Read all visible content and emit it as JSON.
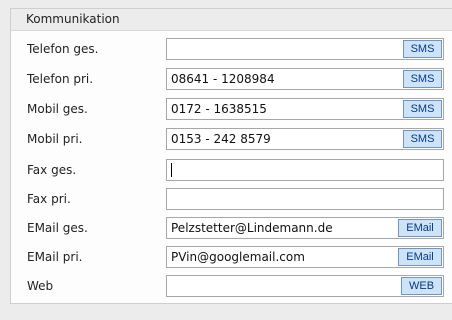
{
  "panel": {
    "title": "Kommunikation"
  },
  "rows": [
    {
      "label": "Telefon ges.",
      "value": "",
      "button": "SMS"
    },
    {
      "label": "Telefon pri.",
      "value": "08641 - 1208984",
      "button": "SMS"
    },
    {
      "label": "Mobil ges.",
      "value": "0172 - 1638515",
      "button": "SMS"
    },
    {
      "label": "Mobil pri.",
      "value": "0153 - 242 8579",
      "button": "SMS"
    },
    {
      "label": "Fax ges.",
      "value": ""
    },
    {
      "label": "Fax pri.",
      "value": ""
    },
    {
      "label": "EMail ges.",
      "value": "Pelzstetter@Lindemann.de",
      "button": "EMail"
    },
    {
      "label": "EMail pri.",
      "value": "PVin@googlemail.com",
      "button": "EMail"
    },
    {
      "label": "Web",
      "value": "",
      "button": "WEB"
    }
  ]
}
